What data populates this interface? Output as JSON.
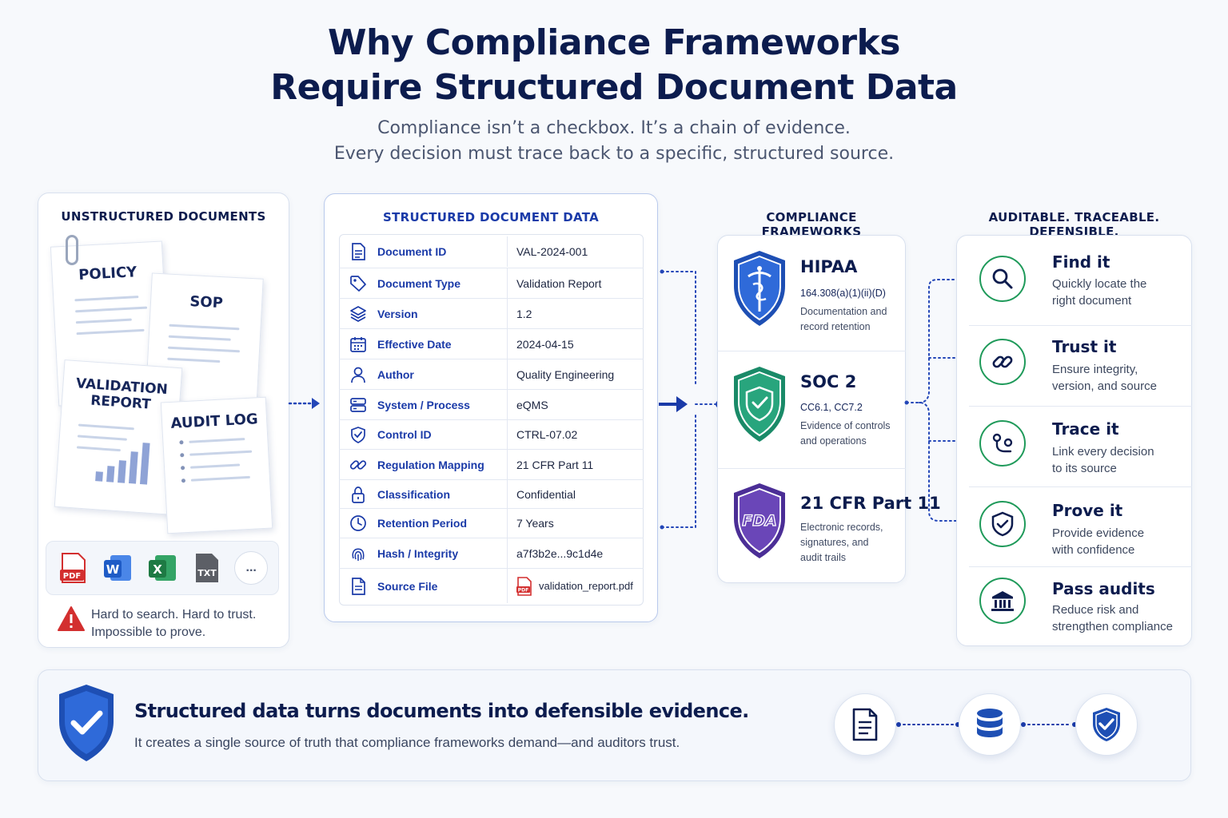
{
  "header": {
    "title_line1": "Why Compliance Frameworks",
    "title_line2": "Require Structured Document Data",
    "subtitle_line1": "Compliance isn’t a checkbox. It’s a chain of evidence.",
    "subtitle_line2": "Every decision must trace back to a specific, structured source."
  },
  "unstructured": {
    "heading": "UNSTRUCTURED DOCUMENTS",
    "docs": [
      "POLICY",
      "SOP",
      "VALIDATION REPORT",
      "AUDIT LOG"
    ],
    "file_types": [
      "PDF",
      "W",
      "X",
      "TXT",
      "..."
    ],
    "warning_line1": "Hard to search. Hard to trust.",
    "warning_line2": "Impossible to prove."
  },
  "structured": {
    "heading": "STRUCTURED DOCUMENT DATA",
    "rows": [
      {
        "icon": "document-icon",
        "key": "Document ID",
        "value": "VAL-2024-001"
      },
      {
        "icon": "tag-icon",
        "key": "Document Type",
        "value": "Validation Report"
      },
      {
        "icon": "layers-icon",
        "key": "Version",
        "value": "1.2"
      },
      {
        "icon": "calendar-icon",
        "key": "Effective Date",
        "value": "2024-04-15"
      },
      {
        "icon": "person-icon",
        "key": "Author",
        "value": "Quality Engineering"
      },
      {
        "icon": "server-icon",
        "key": "System / Process",
        "value": "eQMS"
      },
      {
        "icon": "shield-icon",
        "key": "Control ID",
        "value": "CTRL-07.02"
      },
      {
        "icon": "link-icon",
        "key": "Regulation Mapping",
        "value": "21 CFR Part 11"
      },
      {
        "icon": "lock-icon",
        "key": "Classification",
        "value": "Confidential"
      },
      {
        "icon": "clock-icon",
        "key": "Retention Period",
        "value": "7 Years"
      },
      {
        "icon": "fingerprint-icon",
        "key": "Hash / Integrity",
        "value": "a7f3b2e...9c1d4e"
      },
      {
        "icon": "file-icon",
        "key": "Source File",
        "value": "validation_report.pdf"
      }
    ]
  },
  "frameworks": {
    "heading": "COMPLIANCE FRAMEWORKS",
    "items": [
      {
        "name": "HIPAA",
        "code": "164.308(a)(1)(ii)(D)",
        "desc_line1": "Documentation and",
        "desc_line2": "record retention",
        "desc_line3": "",
        "color": "#1e4fb4"
      },
      {
        "name": "SOC 2",
        "code": "CC6.1, CC7.2",
        "desc_line1": "Evidence of controls",
        "desc_line2": "and operations",
        "desc_line3": "",
        "color": "#1f9a74"
      },
      {
        "name": "21 CFR Part 11",
        "code": "",
        "desc_line1": "Electronic records,",
        "desc_line2": "signatures, and",
        "desc_line3": "audit trails",
        "color": "#5a3aa6"
      }
    ],
    "fda_label": "FDA"
  },
  "outcomes": {
    "heading": "AUDITABLE. TRACEABLE. DEFENSIBLE.",
    "items": [
      {
        "icon": "search-icon",
        "title": "Find it",
        "line1": "Quickly locate the",
        "line2": "right document"
      },
      {
        "icon": "link-icon",
        "title": "Trust it",
        "line1": "Ensure integrity,",
        "line2": "version, and source"
      },
      {
        "icon": "trace-icon",
        "title": "Trace it",
        "line1": "Link every decision",
        "line2": "to its source"
      },
      {
        "icon": "shield-check-icon",
        "title": "Prove it",
        "line1": "Provide evidence",
        "line2": "with confidence"
      },
      {
        "icon": "bank-icon",
        "title": "Pass audits",
        "line1": "Reduce risk and",
        "line2": "strengthen compliance"
      }
    ]
  },
  "footer": {
    "headline": "Structured data turns documents into defensible evidence.",
    "body": "It creates a single source of truth that compliance frameworks demand—and auditors trust."
  },
  "colors": {
    "navy": "#0c1c4e",
    "blue": "#1a3aa8",
    "green": "#1f9a5a",
    "red": "#d32f2f"
  }
}
